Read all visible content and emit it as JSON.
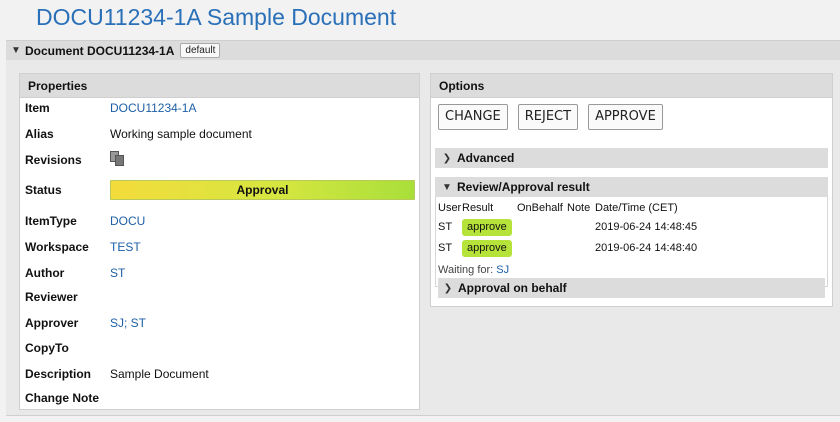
{
  "page_title": "DOCU11234-1A Sample Document",
  "doc_header": {
    "title": "Document DOCU11234-1A",
    "tag": "default"
  },
  "properties": {
    "title": "Properties",
    "rows": {
      "item": {
        "label": "Item",
        "value": "DOCU11234-1A"
      },
      "alias": {
        "label": "Alias",
        "value": "Working sample document"
      },
      "revisions": {
        "label": "Revisions",
        "icon": "copy-icon"
      },
      "status": {
        "label": "Status",
        "value": "Approval",
        "colors": [
          "#f3dc3c",
          "#a9df3a"
        ]
      },
      "itemtype": {
        "label": "ItemType",
        "value": "DOCU"
      },
      "workspace": {
        "label": "Workspace",
        "value": "TEST"
      },
      "author": {
        "label": "Author",
        "value": "ST"
      },
      "reviewer": {
        "label": "Reviewer",
        "value": ""
      },
      "approver": {
        "label": "Approver",
        "value": "SJ; ST"
      },
      "copyto": {
        "label": "CopyTo",
        "value": ""
      },
      "description": {
        "label": "Description",
        "value": "Sample Document"
      },
      "changenote": {
        "label": "Change Note",
        "value": ""
      }
    }
  },
  "options": {
    "title": "Options",
    "buttons": {
      "change": "CHANGE",
      "reject": "REJECT",
      "approve": "APPROVE"
    },
    "advanced": "Advanced",
    "review": {
      "title": "Review/Approval result",
      "columns": {
        "user": "User",
        "result": "Result",
        "onbehalf": "OnBehalf",
        "note": "Note",
        "datetime": "Date/Time (CET)"
      },
      "rows": [
        {
          "user": "ST",
          "result": "approve",
          "onbehalf": "",
          "note": "",
          "datetime": "2019-06-24 14:48:45"
        },
        {
          "user": "ST",
          "result": "approve",
          "onbehalf": "",
          "note": "",
          "datetime": "2019-06-24 14:48:40"
        }
      ],
      "waiting_label": "Waiting for:",
      "waiting_user": "SJ"
    },
    "approval_on_behalf": "Approval on behalf"
  },
  "colors": {
    "accent": "#2a70b8",
    "link": "#1d5fa6",
    "badge": "#b6e33a",
    "header_bg": "#dcdcdc"
  }
}
